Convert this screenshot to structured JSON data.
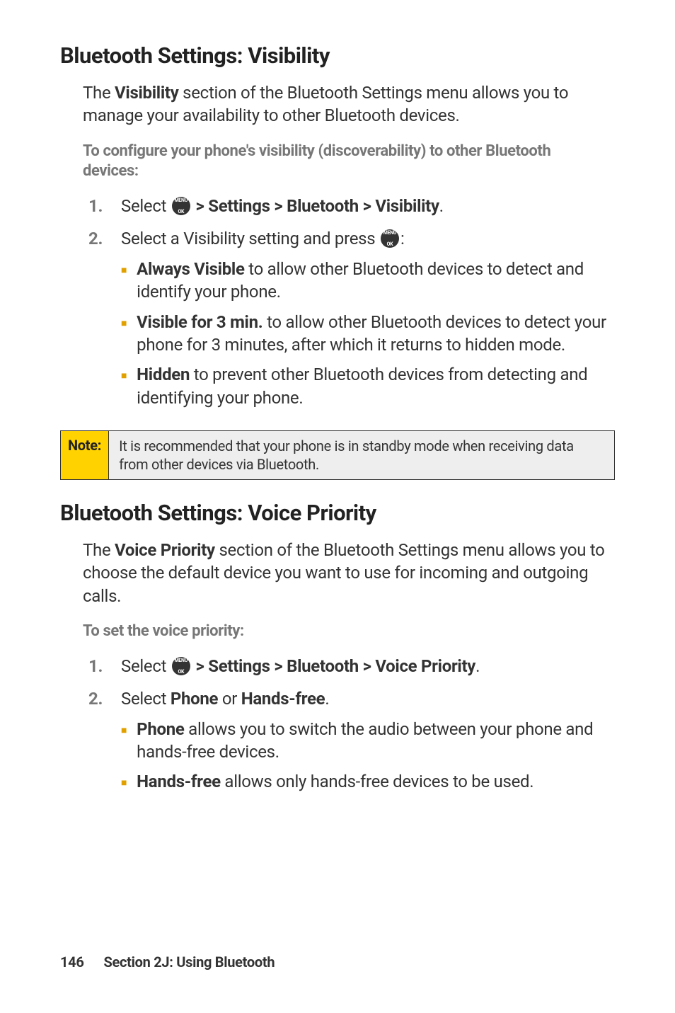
{
  "section1": {
    "title": "Bluetooth Settings: Visibility",
    "lead_part1": "The ",
    "lead_bold": "Visibility",
    "lead_part2": " section of the Bluetooth Settings menu allows you to manage your availability to other Bluetooth devices.",
    "subheading": "To configure your phone's visibility (discoverability) to other Bluetooth devices:",
    "step1_num": "1.",
    "step1_pre": "Select ",
    "step1_path": " > Settings > Bluetooth > Visibility",
    "step1_end": ".",
    "step2_num": "2.",
    "step2_pre": "Select a Visibility setting and press ",
    "step2_end": ":",
    "bullets": {
      "b1_bold": "Always Visible",
      "b1_rest": " to allow other Bluetooth devices to detect and identify your phone.",
      "b2_bold": "Visible for 3 min.",
      "b2_rest": " to allow other Bluetooth devices to detect your phone for 3 minutes, after which it returns to hidden mode.",
      "b3_bold": "Hidden",
      "b3_rest": " to prevent other Bluetooth devices from detecting and identifying your phone."
    }
  },
  "note": {
    "label": "Note:",
    "body": "It is recommended that your phone is in standby mode when receiving data from other devices via Bluetooth."
  },
  "section2": {
    "title": "Bluetooth Settings: Voice Priority",
    "lead_part1": "The ",
    "lead_bold": "Voice Priority",
    "lead_part2": " section of the Bluetooth Settings menu allows you to choose the default device you want to use for incoming and outgoing calls.",
    "subheading": "To set the voice priority:",
    "step1_num": "1.",
    "step1_pre": "Select ",
    "step1_path": " > Settings > Bluetooth > Voice Priority",
    "step1_end": ".",
    "step2_num": "2.",
    "step2_pre": "Select ",
    "step2_b1": "Phone",
    "step2_mid": " or ",
    "step2_b2": "Hands-free",
    "step2_end": ".",
    "bullets": {
      "b1_bold": "Phone",
      "b1_rest": " allows you to switch the audio between your phone and hands-free devices.",
      "b2_bold": "Hands-free",
      "b2_rest": " allows only hands-free devices to be used."
    }
  },
  "icon": {
    "line1": "MENU",
    "line2": "OK"
  },
  "footer": {
    "page": "146",
    "text": "Section 2J: Using Bluetooth"
  }
}
